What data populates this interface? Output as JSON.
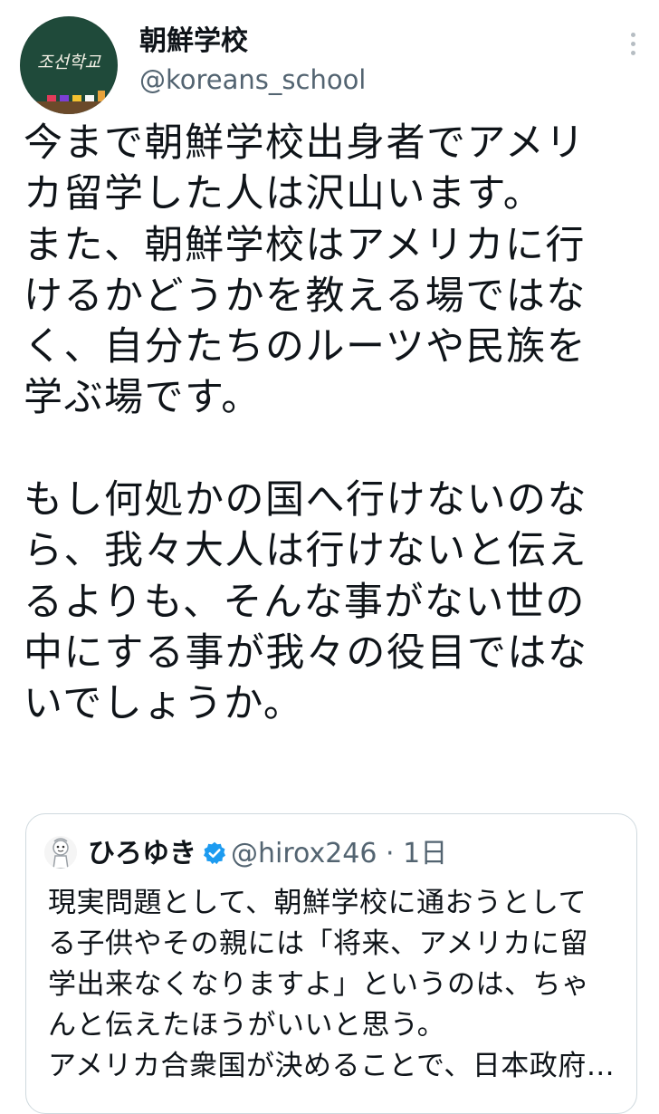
{
  "author": {
    "display_name": "朝鮮学校",
    "handle": "@koreans_school",
    "avatar_text": "조선학교"
  },
  "tweet": {
    "text": "今まで朝鮮学校出身者でアメリ\nカ留学した人は沢山います。\nまた、朝鮮学校はアメリカに行\nけるかどうかを教える場ではな\nく、自分たちのルーツや民族を\n学ぶ場です。\n\nもし何処かの国へ行けないのな\nら、我々大人は行けないと伝え\nるよりも、そんな事がない世の\n中にする事が我々の役目ではな\nいでしょうか。"
  },
  "quoted_tweet": {
    "display_name": "ひろゆき",
    "handle": "@hirox246",
    "separator": "·",
    "time": "1日",
    "text": "現実問題として、朝鮮学校に通おうとして\nる子供やその親には「将来、アメリカに留\n学出来なくなりますよ」というのは、ちゃ\nんと伝えたほうがいいと思う。\nアメリカ合衆国が決めることで、日本政府…"
  },
  "icons": {
    "more": "more-horizontal-icon",
    "verified": "verified-badge-icon"
  },
  "colors": {
    "text_primary": "#0f1419",
    "text_secondary": "#536471",
    "verified_blue": "#1d9bf0",
    "border": "#cfd9de",
    "avatar_board": "#1f4a3a"
  }
}
